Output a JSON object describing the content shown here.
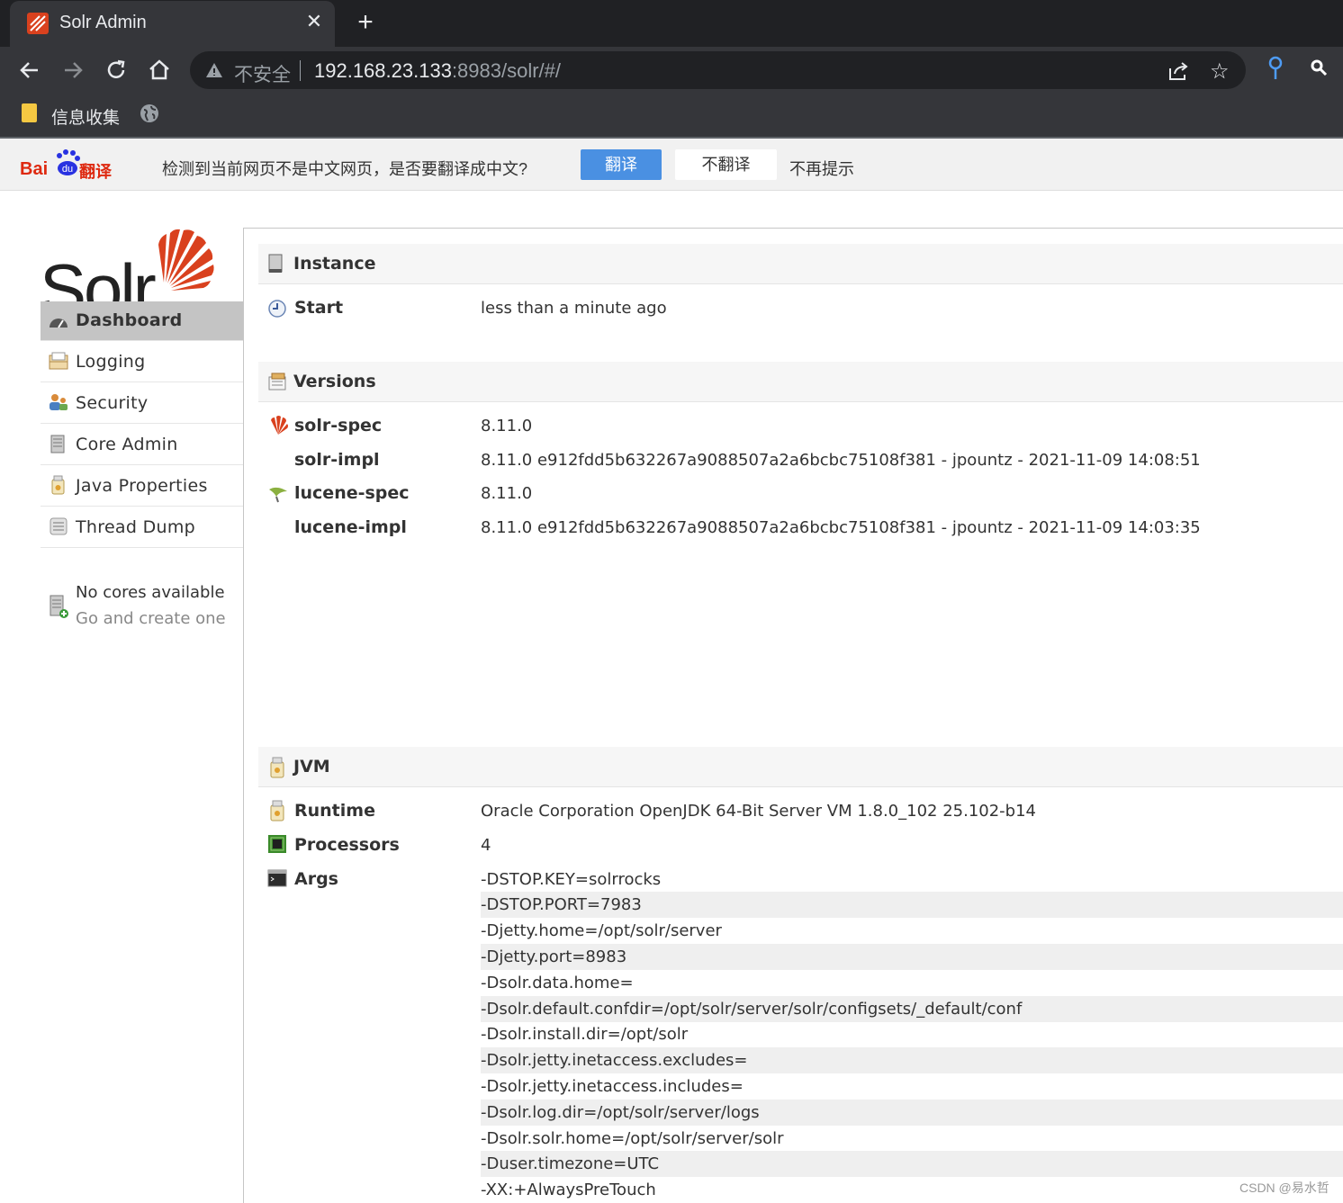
{
  "browser": {
    "tab_title": "Solr Admin",
    "tab_close": "✕",
    "new_tab": "+",
    "security_label": "不安全",
    "url_host": "192.168.23.133",
    "url_rest": ":8983/solr/#/",
    "bookmark_folder": "信息收集"
  },
  "translate_bar": {
    "logo_text": "Bai",
    "logo_suffix": "翻译",
    "message": "检测到当前网页不是中文网页，是否要翻译成中文?",
    "translate_button": "翻译",
    "no_translate_button": "不翻译",
    "no_prompt_link": "不再提示"
  },
  "sidebar": {
    "items": [
      {
        "label": "Dashboard",
        "icon": "dashboard-icon",
        "active": true
      },
      {
        "label": "Logging",
        "icon": "logging-icon"
      },
      {
        "label": "Security",
        "icon": "security-icon"
      },
      {
        "label": "Core Admin",
        "icon": "core-admin-icon"
      },
      {
        "label": "Java Properties",
        "icon": "java-properties-icon"
      },
      {
        "label": "Thread Dump",
        "icon": "thread-dump-icon"
      }
    ],
    "cores_status": "No cores available",
    "cores_link": "Go and create one"
  },
  "instance": {
    "title": "Instance",
    "start_label": "Start",
    "start_value": "less than a minute ago"
  },
  "versions": {
    "title": "Versions",
    "rows": [
      {
        "label": "solr-spec",
        "value": "8.11.0"
      },
      {
        "label": "solr-impl",
        "value": "8.11.0 e912fdd5b632267a9088507a2a6bcbc75108f381 - jpountz - 2021-11-09 14:08:51"
      },
      {
        "label": "lucene-spec",
        "value": "8.11.0"
      },
      {
        "label": "lucene-impl",
        "value": "8.11.0 e912fdd5b632267a9088507a2a6bcbc75108f381 - jpountz - 2021-11-09 14:03:35"
      }
    ]
  },
  "jvm": {
    "title": "JVM",
    "runtime_label": "Runtime",
    "runtime_value": "Oracle Corporation OpenJDK 64-Bit Server VM 1.8.0_102 25.102-b14",
    "processors_label": "Processors",
    "processors_value": "4",
    "args_label": "Args",
    "args": [
      "-DSTOP.KEY=solrrocks",
      "-DSTOP.PORT=7983",
      "-Djetty.home=/opt/solr/server",
      "-Djetty.port=8983",
      "-Dsolr.data.home=",
      "-Dsolr.default.confdir=/opt/solr/server/solr/configsets/_default/conf",
      "-Dsolr.install.dir=/opt/solr",
      "-Dsolr.jetty.inetaccess.excludes=",
      "-Dsolr.jetty.inetaccess.includes=",
      "-Dsolr.log.dir=/opt/solr/server/logs",
      "-Dsolr.solr.home=/opt/solr/server/solr",
      "-Duser.timezone=UTC",
      "-XX:+AlwaysPreTouch"
    ]
  },
  "watermark": "CSDN @易水哲",
  "colors": {
    "solr_orange": "#d9411e",
    "translate_blue": "#4a90e2",
    "active_nav": "#c4c4c4"
  }
}
